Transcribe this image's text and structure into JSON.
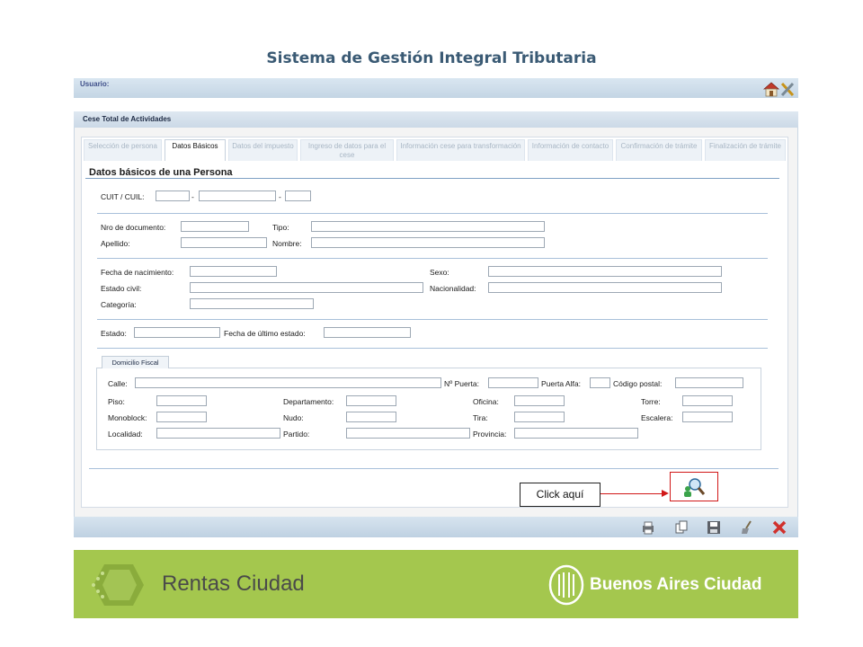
{
  "header": {
    "title": "Sistema de Gestión Integral Tributaria"
  },
  "userbar": {
    "label": "Usuario:"
  },
  "panel": {
    "title": "Cese Total de Actividades"
  },
  "tabs": [
    {
      "label": "Selección de persona"
    },
    {
      "label": "Datos Básicos"
    },
    {
      "label": "Datos del impuesto"
    },
    {
      "label": "Ingreso de datos para el cese"
    },
    {
      "label": "Información cese para transformación"
    },
    {
      "label": "Información de contacto"
    },
    {
      "label": "Confirmación de trámite"
    },
    {
      "label": "Finalización de trámite"
    }
  ],
  "section": {
    "title": "Datos básicos de una Persona"
  },
  "form": {
    "cuit": "CUIT / CUIL:",
    "dash": "-",
    "nro_documento": "Nro de documento:",
    "tipo": "Tipo:",
    "apellido": "Apellido:",
    "nombre": "Nombre:",
    "fecha_nacimiento": "Fecha de nacimiento:",
    "sexo": "Sexo:",
    "estado_civil": "Estado civil:",
    "nacionalidad": "Nacionalidad:",
    "categoria": "Categoría:",
    "estado": "Estado:",
    "fecha_ultimo_estado": "Fecha de último estado:"
  },
  "domicilio": {
    "tab": "Domicilio Fiscal",
    "calle": "Calle:",
    "puerta": "Nº Puerta:",
    "puerta_alfa": "Puerta Alfa:",
    "codigo_postal": "Código postal:",
    "piso": "Piso:",
    "departamento": "Departamento:",
    "oficina": "Oficina:",
    "torre": "Torre:",
    "monoblock": "Monoblock:",
    "nudo": "Nudo:",
    "tira": "Tira:",
    "escalera": "Escalera:",
    "localidad": "Localidad:",
    "partido": "Partido:",
    "provincia": "Provincia:"
  },
  "callout": {
    "text": "Click aquí"
  },
  "footer": {
    "left_brand": "Rentas Ciudad",
    "right_brand": "Buenos Aires Ciudad"
  },
  "colors": {
    "accent_red": "#d11818",
    "footer_green": "#a4c74e",
    "title_blue": "#3a5a74"
  },
  "icons": [
    "home-icon",
    "tools-icon",
    "search-person-icon",
    "print-icon",
    "copy-icon",
    "save-icon",
    "clean-icon",
    "close-icon"
  ]
}
